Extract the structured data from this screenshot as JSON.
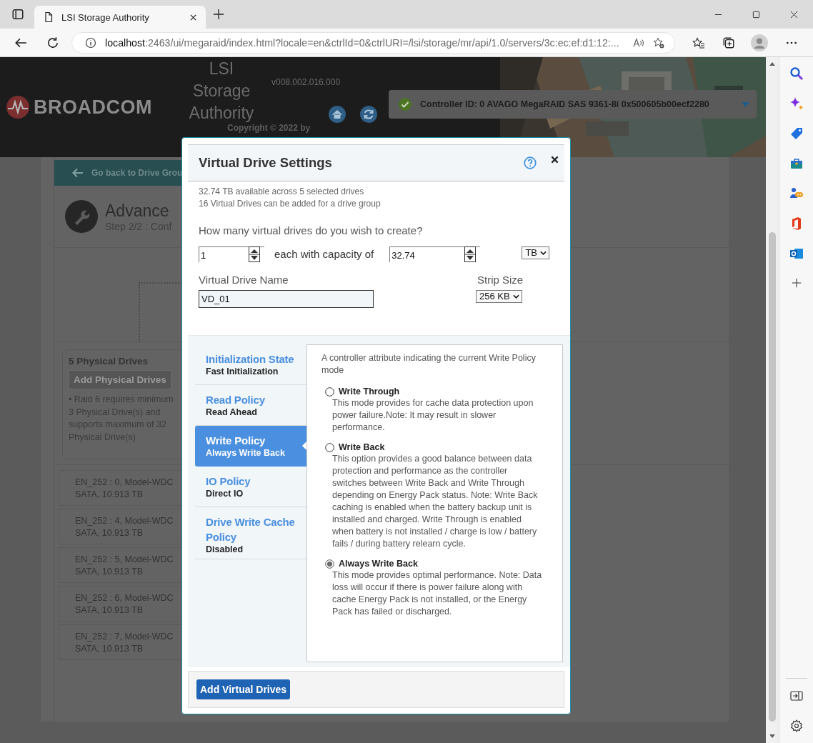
{
  "browser": {
    "tab_title": "LSI Storage Authority",
    "url_host": "localhost",
    "url_rest": ":2463/ui/megaraid/index.html?locale=en&ctrlId=0&ctrlURI=/lsi/storage/mr/api/1.0/servers/3c:ec:ef:d1:12:..."
  },
  "header": {
    "brand": "BROADCOM",
    "product_lines": [
      "LSI",
      "Storage",
      "Authority"
    ],
    "version": "v008.002.016.000",
    "copyright": "Copyright © 2022 by",
    "controller": "Controller ID: 0 AVAGO MegaRAID SAS 9361-8i 0x500605b00ecf2280"
  },
  "page": {
    "back_button": "Go back to Drive Grou",
    "title": "Advance",
    "step": "Step 2/2 : Conf",
    "drives_card": {
      "title": "5 Physical Drives",
      "add_button": {
        "label": "Add Physical Drives",
        "disabled": true
      },
      "notes": [
        "• Raid 6 requires minimum",
        "3 Physical Drive(s) and",
        "supports maximum of 32",
        "Physical Drive(s)"
      ]
    },
    "drives": [
      {
        "line_1": "EN_252 : 0, Model-WDC",
        "line_2": "SATA, 10.913 TB"
      },
      {
        "line_1": "EN_252 : 4, Model-WDC",
        "line_2": "SATA, 10.913 TB"
      },
      {
        "line_1": "EN_252 : 5, Model-WDC",
        "line_2": "SATA, 10.913 TB"
      },
      {
        "line_1": "EN_252 : 6, Model-WDC",
        "line_2": "SATA, 10.913 TB"
      },
      {
        "line_1": "EN_252 : 7, Model-WDC",
        "line_2": "SATA, 10.913 TB"
      }
    ]
  },
  "dialog": {
    "title": "Virtual Drive Settings",
    "info": [
      "32.74 TB available across 5 selected drives",
      "16 Virtual Drives can be added for a drive group"
    ],
    "question": "How many virtual drives do you wish to create?",
    "count": "1",
    "capacity_label": "each with capacity of",
    "capacity": "32.74",
    "unit": "TB",
    "name_label": "Virtual Drive Name",
    "name": "VD_01",
    "strip_label": "Strip Size",
    "strip": "256 KB",
    "tabs": [
      {
        "title": "Initialization State",
        "value": "Fast Initialization",
        "selected": false
      },
      {
        "title": "Read Policy",
        "value": "Read Ahead",
        "selected": false
      },
      {
        "title": "Write Policy",
        "value": "Always Write Back",
        "selected": true
      },
      {
        "title": "IO Policy",
        "value": "Direct IO",
        "selected": false
      },
      {
        "title": "Drive Write Cache Policy",
        "value": "Disabled",
        "selected": false
      }
    ],
    "description": "A controller attribute indicating the current Write Policy mode",
    "options": [
      {
        "label": "Write Through",
        "description": "This mode provides for cache data protection upon power failure.Note: It may result in slower performance.",
        "selected": false
      },
      {
        "label": "Write Back",
        "description": "This option provides a good balance between data protection and performance as the controller switches between Write Back and Write Through depending on Energy Pack status. Note: Write Back caching is enabled when the battery backup unit is installed and charged. Write Through is enabled when battery is not installed / charge is low / battery fails / during battery relearn cycle.",
        "selected": false
      },
      {
        "label": "Always Write Back",
        "description": "This mode provides optimal performance. Note: Data loss will occur if there is power failure along with cache Energy Pack is not installed, or the Energy Pack has failed or discharged.",
        "selected": true
      }
    ],
    "button": "Add Virtual Drives"
  }
}
